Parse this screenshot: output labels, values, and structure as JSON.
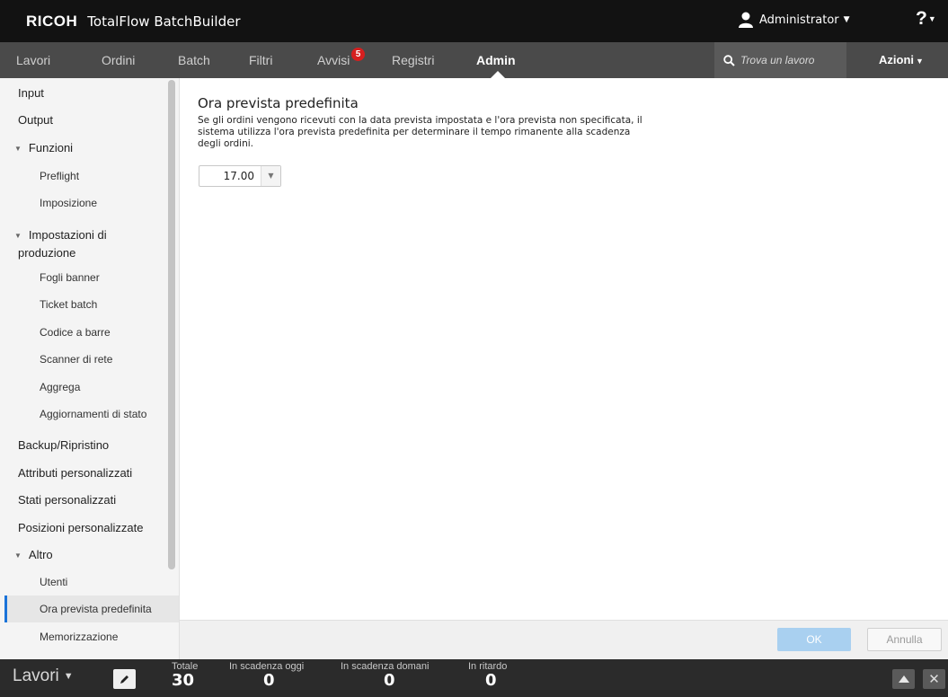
{
  "header": {
    "logo": "RICOH",
    "product": "TotalFlow BatchBuilder",
    "user": "Administrator",
    "help": "?"
  },
  "nav": {
    "tabs": [
      "Lavori",
      "Ordini",
      "Batch",
      "Filtri",
      "Avvisi",
      "Registri",
      "Admin"
    ],
    "active_tab": "Admin",
    "alerts_badge": "5",
    "search_placeholder": "Trova un lavoro",
    "actions": "Azioni"
  },
  "sidebar": {
    "input": "Input",
    "output": "Output",
    "funzioni": "Funzioni",
    "preflight": "Preflight",
    "imposizione": "Imposizione",
    "impostazioni_line1": "Impostazioni di",
    "impostazioni_line2": "produzione",
    "fogli_banner": "Fogli banner",
    "ticket_batch": "Ticket batch",
    "codice_barre": "Codice a barre",
    "scanner_rete": "Scanner di rete",
    "aggrega": "Aggrega",
    "aggiornamenti": "Aggiornamenti di stato",
    "backup": "Backup/Ripristino",
    "attributi": "Attributi personalizzati",
    "stati": "Stati personalizzati",
    "posizioni": "Posizioni personalizzate",
    "altro": "Altro",
    "utenti": "Utenti",
    "ora_prevista": "Ora prevista predefinita",
    "memorizzazione": "Memorizzazione"
  },
  "main": {
    "title": "Ora prevista predefinita",
    "description": "Se gli ordini vengono ricevuti con la data prevista impostata e l'ora prevista non specificata, il sistema utilizza l'ora prevista predefinita per determinare il tempo rimanente alla scadenza degli ordini.",
    "time_value": "17.00"
  },
  "buttons": {
    "ok": "OK",
    "cancel": "Annulla"
  },
  "footer": {
    "lavori": "Lavori",
    "stats": [
      {
        "label": "Totale",
        "value": "30"
      },
      {
        "label": "In scadenza oggi",
        "value": "0"
      },
      {
        "label": "In scadenza domani",
        "value": "0"
      },
      {
        "label": "In ritardo",
        "value": "0"
      }
    ]
  },
  "colors": {
    "header_bg": "#121212",
    "nav_bg": "#4a4a4a",
    "badge": "#d61f1f",
    "selection_accent": "#1a73d9",
    "ok_button": "#a9d0f0",
    "footer_bg": "#2b2b2b"
  }
}
